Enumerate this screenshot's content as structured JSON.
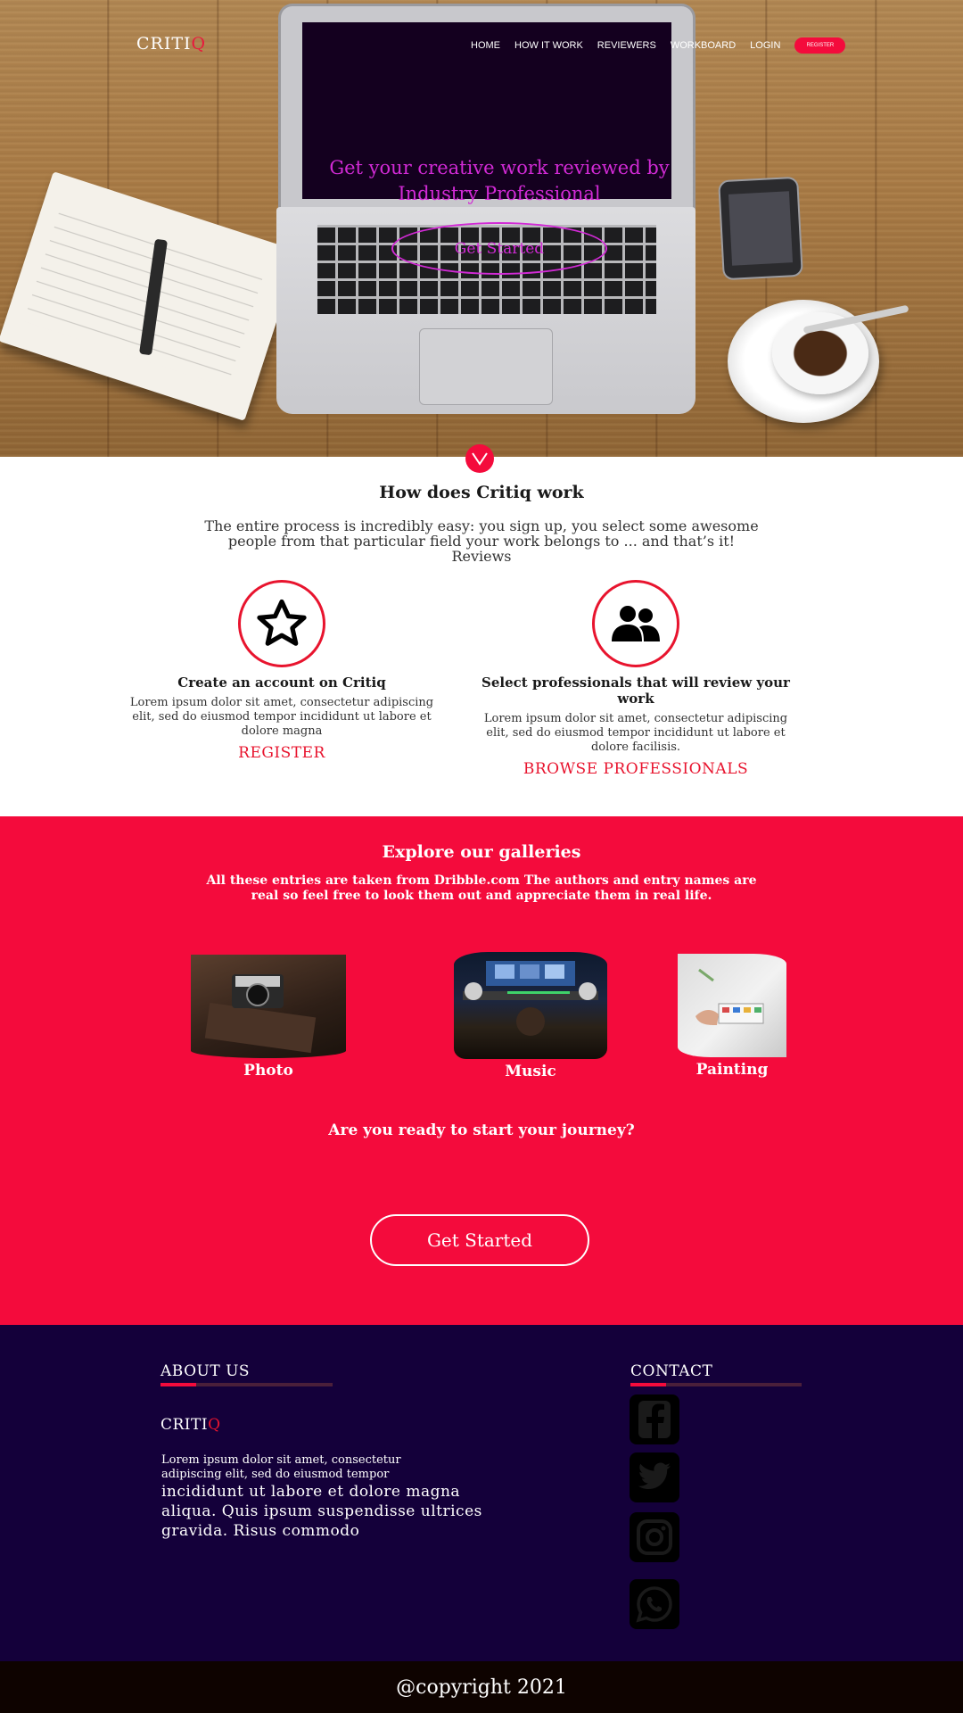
{
  "nav": {
    "logo_main": "CRITI",
    "logo_accent": "Q",
    "links": [
      "HOME",
      "HOW IT WORK",
      "REVIEWERS",
      "WORKBOARD",
      "LOGIN"
    ],
    "register_label": "REGISTER"
  },
  "hero": {
    "headline": "Get your creative work reviewed by Industry Professional",
    "cta_label": "Get Started"
  },
  "how": {
    "title": "How does Critiq work",
    "description": "The entire process is incredibly easy: you sign up, you select some awesome people from that particular field your work belongs to ... and that’s it! Reviews",
    "steps": [
      {
        "icon": "star-icon",
        "title": "Create an account on Critiq",
        "body": "Lorem ipsum dolor sit amet, consectetur adipiscing elit, sed do eiusmod tempor incididunt ut labore et dolore magna",
        "link": "REGISTER"
      },
      {
        "icon": "users-icon",
        "title": "Select professionals that will review your work",
        "body": "Lorem ipsum dolor sit amet, consectetur adipiscing elit, sed do eiusmod tempor incididunt ut labore et dolore facilisis.",
        "link": "BROWSE PROFESSIONALS"
      }
    ]
  },
  "galleries": {
    "title": "Explore our galleries",
    "description": "All these entries are taken from Dribble.com The authors and entry names are real so feel free to look them out and appreciate them in real life.",
    "items": [
      "Photo",
      "Music",
      "Painting"
    ],
    "question": "Are you ready to start your journey?",
    "cta_label": "Get Started"
  },
  "footer": {
    "about_heading": "ABOUT US",
    "contact_heading": "CONTACT",
    "logo_main": "CRITI",
    "logo_accent": "Q",
    "about_small": "Lorem ipsum dolor sit amet, consectetur adipiscing elit, sed do eiusmod tempor",
    "about_big": "incididunt ut labore et dolore magna aliqua. Quis ipsum suspendisse ultrices gravida. Risus commodo",
    "social": [
      "facebook-icon",
      "twitter-icon",
      "instagram-icon",
      "whatsapp-icon"
    ],
    "copyright": "@copyright 2021"
  },
  "colors": {
    "accent_red": "#f40b3c",
    "hero_headline": "#d22ad6",
    "footer_bg": "#14003a",
    "copyright_bg": "#0e0300"
  }
}
